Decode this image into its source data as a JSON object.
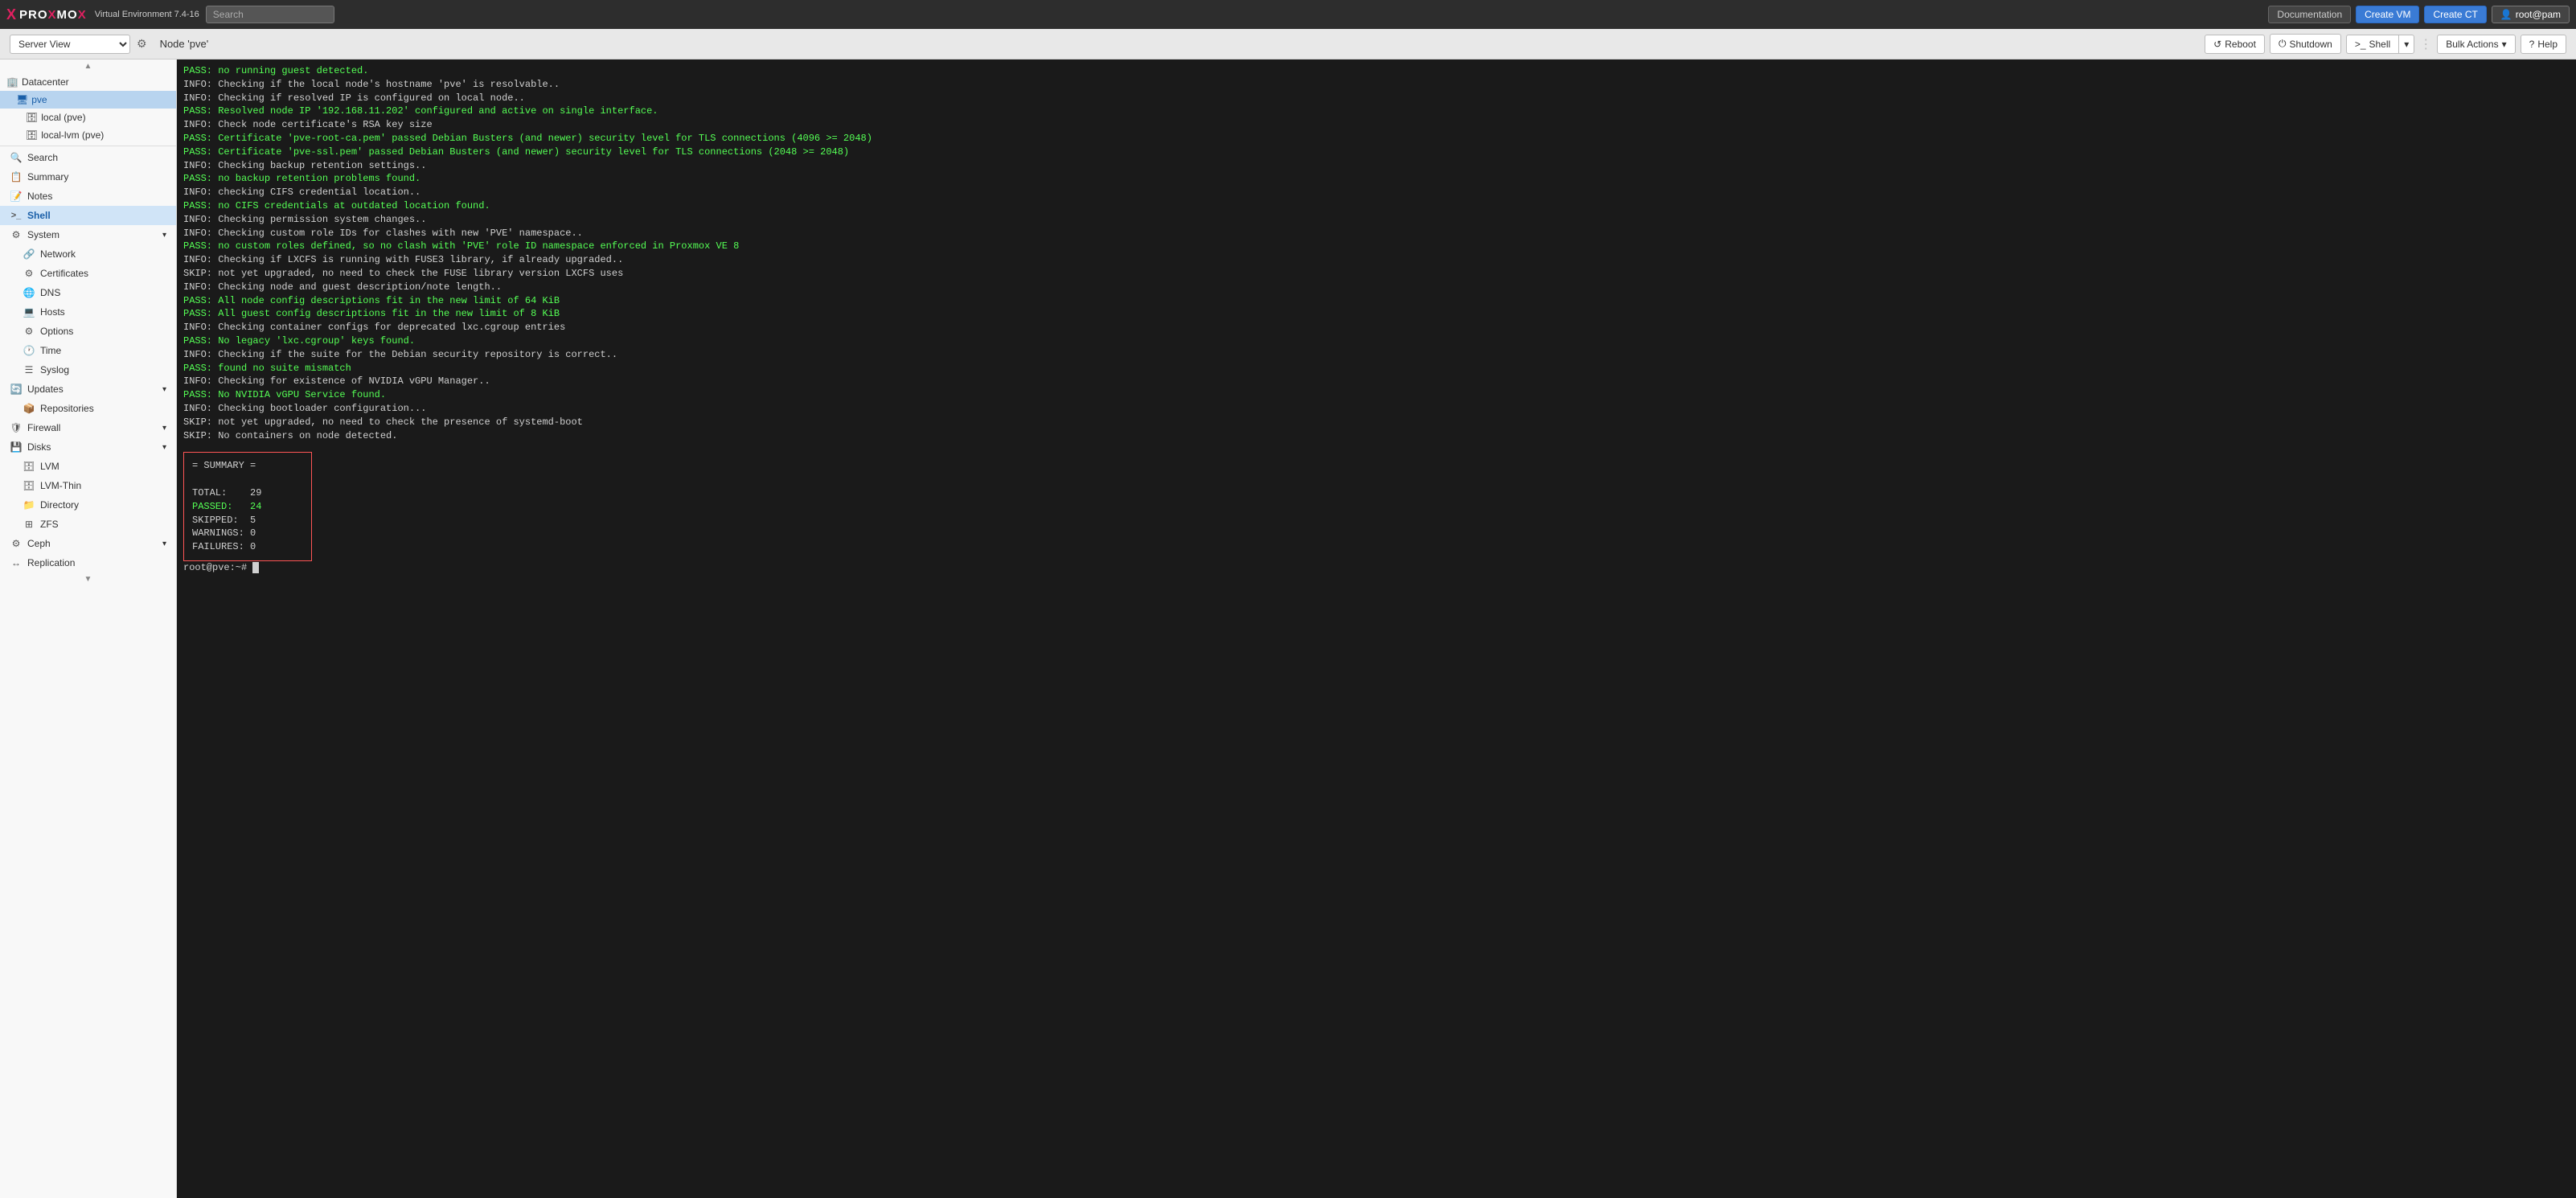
{
  "topbar": {
    "logo": {
      "x": "X",
      "brand1": "PRO",
      "brand2": "X",
      "brand3": "MO",
      "brand4": "X",
      "subtitle": "Virtual Environment 7.4-16"
    },
    "search_placeholder": "Search",
    "buttons": {
      "documentation": "Documentation",
      "create_vm": "Create VM",
      "create_ct": "Create CT",
      "user": "root@pam"
    }
  },
  "secondbar": {
    "server_view": "Server View",
    "node_title": "Node 'pve'",
    "reboot": "Reboot",
    "shutdown": "Shutdown",
    "shell": "Shell",
    "bulk_actions": "Bulk Actions",
    "help": "Help"
  },
  "sidebar": {
    "datacenter_label": "Datacenter",
    "pve_label": "pve",
    "local_pve_label": "local (pve)",
    "local_lvm_label": "local-lvm (pve)",
    "items": [
      {
        "id": "search",
        "label": "Search",
        "icon": "🔍"
      },
      {
        "id": "summary",
        "label": "Summary",
        "icon": "📋"
      },
      {
        "id": "notes",
        "label": "Notes",
        "icon": "📝"
      },
      {
        "id": "shell",
        "label": "Shell",
        "icon": ">_",
        "active": true
      },
      {
        "id": "system",
        "label": "System",
        "icon": "⚙",
        "expandable": true
      },
      {
        "id": "network",
        "label": "Network",
        "icon": "🔗",
        "indent": true
      },
      {
        "id": "certificates",
        "label": "Certificates",
        "icon": "⚙",
        "indent": true
      },
      {
        "id": "dns",
        "label": "DNS",
        "icon": "🌐",
        "indent": true
      },
      {
        "id": "hosts",
        "label": "Hosts",
        "icon": "💻",
        "indent": true
      },
      {
        "id": "options",
        "label": "Options",
        "icon": "⚙",
        "indent": true
      },
      {
        "id": "time",
        "label": "Time",
        "icon": "🕐",
        "indent": true
      },
      {
        "id": "syslog",
        "label": "Syslog",
        "icon": "☰",
        "indent": true
      },
      {
        "id": "updates",
        "label": "Updates",
        "icon": "🔄",
        "expandable": true
      },
      {
        "id": "repositories",
        "label": "Repositories",
        "icon": "📦",
        "indent": true
      },
      {
        "id": "firewall",
        "label": "Firewall",
        "icon": "🛡",
        "expandable": true
      },
      {
        "id": "disks",
        "label": "Disks",
        "icon": "💾",
        "expandable": true
      },
      {
        "id": "lvm",
        "label": "LVM",
        "icon": "🗄",
        "indent": true
      },
      {
        "id": "lvm-thin",
        "label": "LVM-Thin",
        "icon": "🗄",
        "indent": true
      },
      {
        "id": "directory",
        "label": "Directory",
        "icon": "📁",
        "indent": true
      },
      {
        "id": "zfs",
        "label": "ZFS",
        "icon": "⊞",
        "indent": true
      },
      {
        "id": "ceph",
        "label": "Ceph",
        "icon": "⚙",
        "expandable": true
      },
      {
        "id": "replication",
        "label": "Replication",
        "icon": "↔"
      }
    ]
  },
  "terminal": {
    "lines": [
      {
        "type": "pass",
        "text": "PASS: no running guest detected."
      },
      {
        "type": "info",
        "text": "INFO: Checking if the local node's hostname 'pve' is resolvable.."
      },
      {
        "type": "info",
        "text": "INFO: Checking if resolved IP is configured on local node.."
      },
      {
        "type": "pass",
        "text": "PASS: Resolved node IP '192.168.11.202' configured and active on single interface."
      },
      {
        "type": "info",
        "text": "INFO: Check node certificate's RSA key size"
      },
      {
        "type": "pass",
        "text": "PASS: Certificate 'pve-root-ca.pem' passed Debian Busters (and newer) security level for TLS connections (4096 >= 2048)"
      },
      {
        "type": "pass",
        "text": "PASS: Certificate 'pve-ssl.pem' passed Debian Busters (and newer) security level for TLS connections (2048 >= 2048)"
      },
      {
        "type": "info",
        "text": "INFO: Checking backup retention settings.."
      },
      {
        "type": "pass",
        "text": "PASS: no backup retention problems found."
      },
      {
        "type": "info",
        "text": "INFO: checking CIFS credential location.."
      },
      {
        "type": "pass",
        "text": "PASS: no CIFS credentials at outdated location found."
      },
      {
        "type": "info",
        "text": "INFO: Checking permission system changes.."
      },
      {
        "type": "info",
        "text": "INFO: Checking custom role IDs for clashes with new 'PVE' namespace.."
      },
      {
        "type": "pass",
        "text": "PASS: no custom roles defined, so no clash with 'PVE' role ID namespace enforced in Proxmox VE 8"
      },
      {
        "type": "info",
        "text": "INFO: Checking if LXCFS is running with FUSE3 library, if already upgraded.."
      },
      {
        "type": "skip",
        "text": "SKIP: not yet upgraded, no need to check the FUSE library version LXCFS uses"
      },
      {
        "type": "info",
        "text": "INFO: Checking node and guest description/note length.."
      },
      {
        "type": "pass",
        "text": "PASS: All node config descriptions fit in the new limit of 64 KiB"
      },
      {
        "type": "pass",
        "text": "PASS: All guest config descriptions fit in the new limit of 8 KiB"
      },
      {
        "type": "info",
        "text": "INFO: Checking container configs for deprecated lxc.cgroup entries"
      },
      {
        "type": "pass",
        "text": "PASS: No legacy 'lxc.cgroup' keys found."
      },
      {
        "type": "info",
        "text": "INFO: Checking if the suite for the Debian security repository is correct.."
      },
      {
        "type": "pass",
        "text": "PASS: found no suite mismatch"
      },
      {
        "type": "info",
        "text": "INFO: Checking for existence of NVIDIA vGPU Manager.."
      },
      {
        "type": "pass",
        "text": "PASS: No NVIDIA vGPU Service found."
      },
      {
        "type": "info",
        "text": "INFO: Checking bootloader configuration..."
      },
      {
        "type": "skip",
        "text": "SKIP: not yet upgraded, no need to check the presence of systemd-boot"
      },
      {
        "type": "skip",
        "text": "SKIP: No containers on node detected."
      }
    ],
    "summary": {
      "title": "= SUMMARY =",
      "total_label": "TOTAL:",
      "total_value": "29",
      "passed_label": "PASSED:",
      "passed_value": "24",
      "skipped_label": "SKIPPED:",
      "skipped_value": "5",
      "warnings_label": "WARNINGS:",
      "warnings_value": "0",
      "failures_label": "FAILURES:",
      "failures_value": "0"
    },
    "prompt": "root@pve:~#"
  }
}
